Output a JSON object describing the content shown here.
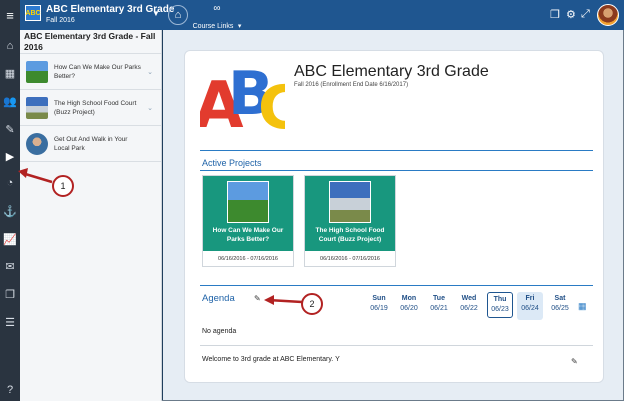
{
  "topbar": {
    "menu_icon": "hamburger-icon",
    "course_title": "ABC Elementary 3rd Grade",
    "course_term": "Fall 2016",
    "course_links_label": "Course Links"
  },
  "sidebar": {
    "heading": "ABC Elementary 3rd Grade - Fall 2016",
    "items": [
      {
        "label": "How Can We Make Our Parks Better?"
      },
      {
        "label": "The High School Food Court (Buzz Project)"
      },
      {
        "label": "Get Out And Walk in Your Local Park"
      }
    ]
  },
  "main": {
    "title": "ABC Elementary 3rd Grade",
    "subtitle": "Fall 2016 (Enrollment End Date 6/16/2017)",
    "active_projects_label": "Active Projects",
    "projects": [
      {
        "name": "How Can We Make Our Parks Better?",
        "dates": "06/16/2016 - 07/16/2016"
      },
      {
        "name": "The High School Food Court (Buzz Project)",
        "dates": "06/16/2016 - 07/16/2016"
      }
    ],
    "agenda_label": "Agenda",
    "days": [
      {
        "name": "Sun",
        "date": "06/19"
      },
      {
        "name": "Mon",
        "date": "06/20"
      },
      {
        "name": "Tue",
        "date": "06/21"
      },
      {
        "name": "Wed",
        "date": "06/22"
      },
      {
        "name": "Thu",
        "date": "06/23"
      },
      {
        "name": "Fri",
        "date": "06/24"
      },
      {
        "name": "Sat",
        "date": "06/25"
      }
    ],
    "no_agenda": "No agenda",
    "welcome": "Welcome to 3rd grade at ABC Elementary. Y"
  },
  "callouts": [
    "1",
    "2"
  ],
  "colors": {
    "topbar": "#1f5690",
    "rail": "#2a3440",
    "project_tile": "#18977e",
    "accent": "#1f63a8",
    "callout_border": "#b22222"
  }
}
